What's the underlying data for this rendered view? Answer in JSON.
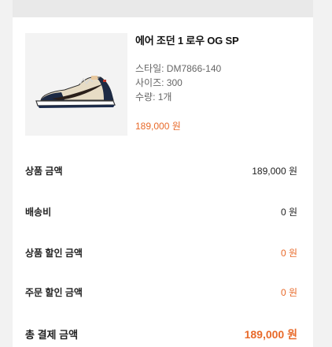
{
  "product": {
    "name": "에어 조던 1 로우 OG SP",
    "style": "스타일: DM7866-140",
    "size": "사이즈: 300",
    "quantity": "수량: 1개",
    "price": "189,000 원",
    "image_alt": "Air Jordan 1 Low OG SP sneaker"
  },
  "summary": {
    "rows": [
      {
        "label": "상품 금액",
        "value": "189,000 원"
      },
      {
        "label": "배송비",
        "value": "0 원"
      },
      {
        "label": "상품 할인 금액",
        "value": "0 원"
      },
      {
        "label": "주문 할인 금액",
        "value": "0 원"
      },
      {
        "label": "총 결제 금액",
        "value": "189,000 원"
      }
    ]
  },
  "colors": {
    "accent": "#e86a2a",
    "text": "#222222",
    "muted": "#666666"
  }
}
